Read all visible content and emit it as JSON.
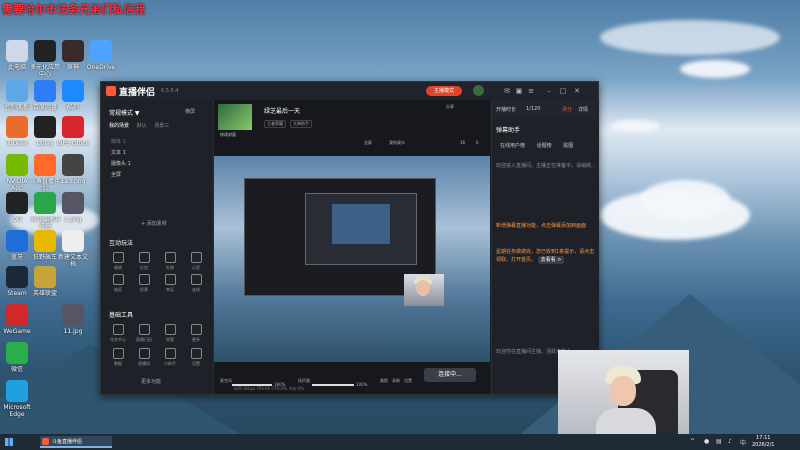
{
  "watermark": "需要哈尔市法务兄弟们私信我",
  "desktop_icons": [
    {
      "label": "此电脑",
      "color": "#cfd8e6"
    },
    {
      "label": "多元化应用中心",
      "color": "#222"
    },
    {
      "label": "原神",
      "color": "#3a2a2a"
    },
    {
      "label": "OneDrive",
      "color": "#4da3ff"
    },
    {
      "label": "控制面板",
      "color": "#5fa8e8"
    },
    {
      "label": "百度网盘",
      "color": "#2e7cf6"
    },
    {
      "label": "酷狗",
      "color": "#1e88ff"
    },
    {
      "label": "ToDesk",
      "color": "#e86c2c"
    },
    {
      "label": "Uplay",
      "color": "#222"
    },
    {
      "label": "WPS Office",
      "color": "#d8262e"
    },
    {
      "label": "NVIDIA App",
      "color": "#77b900"
    },
    {
      "label": "斗鱼直播伴侣",
      "color": "#ff6a2c"
    },
    {
      "label": "123.png",
      "color": "#444"
    },
    {
      "label": "QQ",
      "color": "#222"
    },
    {
      "label": "360极速浏览器",
      "color": "#2aa748"
    },
    {
      "label": "1.png",
      "color": "#556"
    },
    {
      "label": "蓝牙",
      "color": "#1f6dd8"
    },
    {
      "label": "狂野飙车",
      "color": "#e6b800"
    },
    {
      "label": "新建文本文档",
      "color": "#eee"
    },
    {
      "label": "Steam",
      "color": "#1b2838"
    },
    {
      "label": "英雄联盟",
      "color": "#c8a23a"
    },
    {
      "label": "WeGame",
      "color": "#d2282c"
    },
    {
      "label": "11.jpg",
      "color": "#556"
    },
    {
      "label": "微信",
      "color": "#2aae4a"
    },
    {
      "label": "Microsoft Edge",
      "color": "#1fa1e0"
    }
  ],
  "app": {
    "title": "直播伴侣",
    "version": "6.5.5.4",
    "main_live_btn": "主播模式",
    "left": {
      "scene_mode": "常规模式 ▼",
      "right_label": "横屏",
      "tabs": [
        "我的场景",
        "默认",
        "场景三"
      ],
      "sources": [
        "媒体 1",
        "文本 1",
        "摄像头 1",
        "全屏"
      ],
      "add_source": "+ 添加素材",
      "interact_title": "互动玩法",
      "interact_tools": [
        "福袋",
        "红包",
        "礼物",
        "心愿",
        "抽奖",
        "投票",
        "幸运",
        "连线"
      ],
      "basic_title": "基础工具",
      "basic_tools": [
        "任务中心",
        "直播日历",
        "房管",
        "更多",
        "数据",
        "直播间",
        "小助手",
        "设置"
      ],
      "more": "更多功能"
    },
    "center": {
      "room_title": "绿芝最后一天",
      "thumb_label": "修改封面",
      "chips": [
        "王者荣耀",
        "大神助手"
      ],
      "toolbar": [
        "全屏",
        "我的观众",
        "分享"
      ],
      "count_a": "16",
      "count_b": "0",
      "mic_label": "麦克风",
      "mic_value": "180%",
      "speaker_label": "扬声器",
      "speaker_value": "100%",
      "beauty": "美颜",
      "record": "录制",
      "setting": "设置",
      "live_btn": "连接中...",
      "status": "码率 0kbps  FPS:60  CPU:0%  内存:0%"
    },
    "right": {
      "top_items": [
        "开播时长",
        "1/120",
        "评分",
        "详情"
      ],
      "title": "弹幕助手",
      "tabs": [
        "在线用户榜",
        "话题榜",
        "贴图"
      ],
      "msg1": "欢迎进入直播间，主播正在准备中，请稍候...",
      "msg2": "新增弹幕直播功能，点击弹幕添加到画面",
      "msg3": "星期任务做做完，您已收到1条提示，请点击领取，打开首页。",
      "go_btn": "去看看 >",
      "msg4": "欢迎你在直播间主播，活跃户新人"
    }
  },
  "taskbar": {
    "app_label": "斗鱼直播伴侣",
    "time": "17:11",
    "date": "2026/2/1"
  }
}
